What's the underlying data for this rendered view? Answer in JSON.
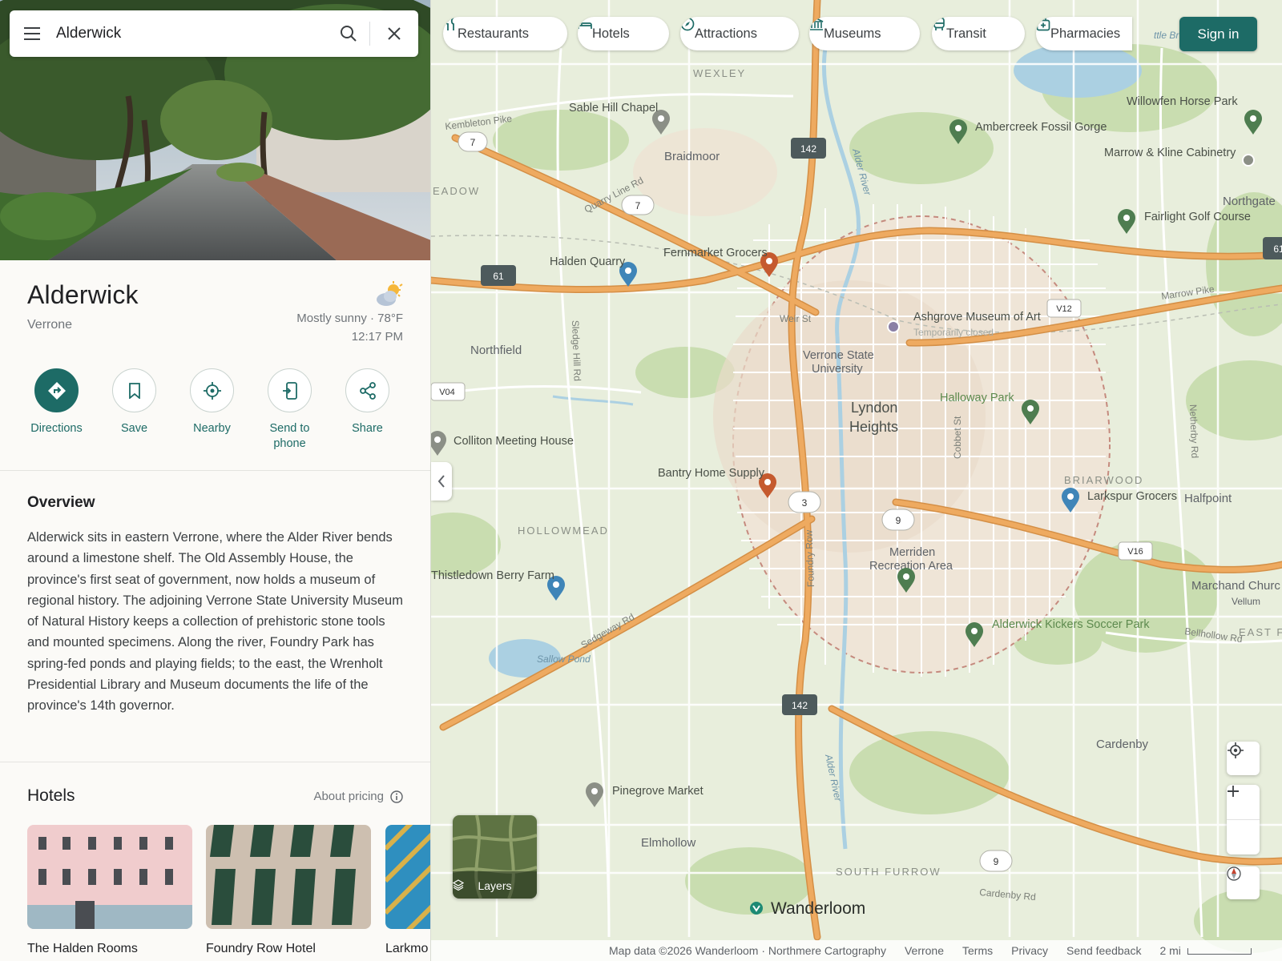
{
  "search": {
    "query": "Alderwick"
  },
  "place": {
    "title": "Alderwick",
    "subtitle": "Verrone",
    "weather": "Mostly sunny · 78°F",
    "time": "12:17 PM"
  },
  "actions": [
    {
      "label": "Directions"
    },
    {
      "label": "Save"
    },
    {
      "label": "Nearby"
    },
    {
      "label": "Send to phone"
    },
    {
      "label": "Share"
    }
  ],
  "overview": {
    "heading": "Overview",
    "text": "Alderwick sits in eastern Verrone, where the Alder River bends around a limestone shelf. The Old Assembly House, the province's first seat of government, now holds a museum of regional history. The adjoining Verrone State University Museum of Natural History keeps a collection of prehistoric stone tools and mounted specimens. Along the river, Foundry Park has spring-fed ponds and playing fields; to the east, the Wrenholt Presidential Library and Museum documents the life of the province's 14th governor."
  },
  "hotels": {
    "heading": "Hotels",
    "pricing_label": "About pricing",
    "items": [
      {
        "name": "The Halden Rooms"
      },
      {
        "name": "Foundry Row Hotel"
      },
      {
        "name": "Larkmo"
      }
    ]
  },
  "chips": [
    {
      "label": "Restaurants",
      "icon": "utensils-icon"
    },
    {
      "label": "Hotels",
      "icon": "bed-icon"
    },
    {
      "label": "Attractions",
      "icon": "compass-icon"
    },
    {
      "label": "Museums",
      "icon": "museum-icon"
    },
    {
      "label": "Transit",
      "icon": "bus-icon"
    },
    {
      "label": "Pharmacies",
      "icon": "medical-bag-icon"
    }
  ],
  "signin": "Sign in",
  "layers_label": "Layers",
  "footer": {
    "attribution": "Map data ©2026 Wanderloom · Northmere Cartography",
    "region": "Verrone",
    "terms": "Terms",
    "privacy": "Privacy",
    "feedback": "Send feedback",
    "scale": "2 mi"
  },
  "brand": "Wanderloom",
  "colors": {
    "accent": "#1d6b66",
    "road": "#e9a55a",
    "water": "#a9cfe0",
    "park": "#c6dcab",
    "urban": "#efe4d6"
  },
  "map": {
    "districts": [
      "WEXLEY",
      "HOLLOWMEAD",
      "BRIARWOOD",
      "SOUTH FURROW",
      "EAST FUR",
      "EADOW"
    ],
    "places": [
      "Braidmoor",
      "Northfield",
      "Lyndon",
      "Heights",
      "Elmhollow",
      "Cardenby",
      "Northgate",
      "Verrone State",
      "University",
      "Merriden",
      "Recreation Area",
      "Halfpoint",
      "Marchand Churc",
      "Vellum"
    ],
    "roads": [
      "Kembleton Pike",
      "Quarry Line Rd",
      "Sledge Hill Rd",
      "Sedgeway Rd",
      "Marrow Pike",
      "Cobbet St",
      "Foundry Row",
      "Weir St",
      "Netherby Rd",
      "Bellhollow Rd",
      "Cardenby Rd",
      "Alder River",
      "Sallow Pond",
      "ttle Br"
    ],
    "shields": [
      "7",
      "7",
      "142",
      "61",
      "V04",
      "V12",
      "3",
      "9",
      "V16",
      "142",
      "9",
      "61"
    ],
    "pois": [
      {
        "name": "Sable Hill Chapel"
      },
      {
        "name": "Ambercreek Fossil Gorge"
      },
      {
        "name": "Willowfen Horse Park"
      },
      {
        "name": "Marrow & Kline Cabinetry"
      },
      {
        "name": "Fairlight Golf Course"
      },
      {
        "name": "Halden Quarry"
      },
      {
        "name": "Fernmarket Grocers"
      },
      {
        "name": "Ashgrove Museum of Art",
        "note": "Temporarily closed"
      },
      {
        "name": "Halloway Park"
      },
      {
        "name": "Colliton Meeting House"
      },
      {
        "name": "Bantry Home Supply"
      },
      {
        "name": "Larkspur Grocers"
      },
      {
        "name": "Thistledown Berry Farm"
      },
      {
        "name": "Alderwick Kickers Soccer Park"
      },
      {
        "name": "Pinegrove Market"
      }
    ]
  }
}
